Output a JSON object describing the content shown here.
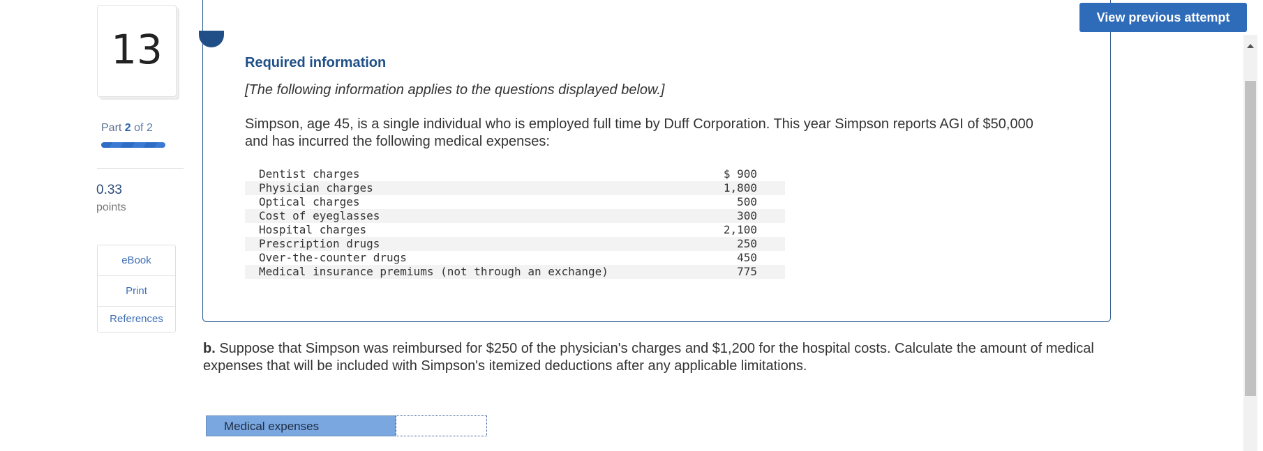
{
  "question": {
    "number": "13",
    "part_label": "Part",
    "part_current": "2",
    "part_of": "of 2",
    "points_value": "0.33",
    "points_label": "points"
  },
  "tools": [
    "eBook",
    "Print",
    "References"
  ],
  "header_button": "View previous attempt",
  "info": {
    "title": "Required information",
    "note": "[The following information applies to the questions displayed below.]",
    "body": "Simpson, age 45, is a single individual who is employed full time by Duff Corporation. This year Simpson reports AGI of $50,000 and has incurred the following medical expenses:"
  },
  "expenses": [
    {
      "label": "Dentist charges",
      "amount": "$ 900"
    },
    {
      "label": "Physician charges",
      "amount": "1,800"
    },
    {
      "label": "Optical charges",
      "amount": "500"
    },
    {
      "label": "Cost of eyeglasses",
      "amount": "300"
    },
    {
      "label": "Hospital charges",
      "amount": "2,100"
    },
    {
      "label": "Prescription drugs",
      "amount": "250"
    },
    {
      "label": "Over-the-counter drugs",
      "amount": "450"
    },
    {
      "label": "Medical insurance premiums (not through an exchange)",
      "amount": "775"
    }
  ],
  "part_b": {
    "prefix": "b.",
    "text": " Suppose that Simpson was reimbursed for $250 of the physician's charges and $1,200 for the hospital costs. Calculate the amount of medical expenses that will be included with Simpson's itemized deductions after any applicable limitations."
  },
  "answer": {
    "label": "Medical expenses",
    "value": ""
  }
}
